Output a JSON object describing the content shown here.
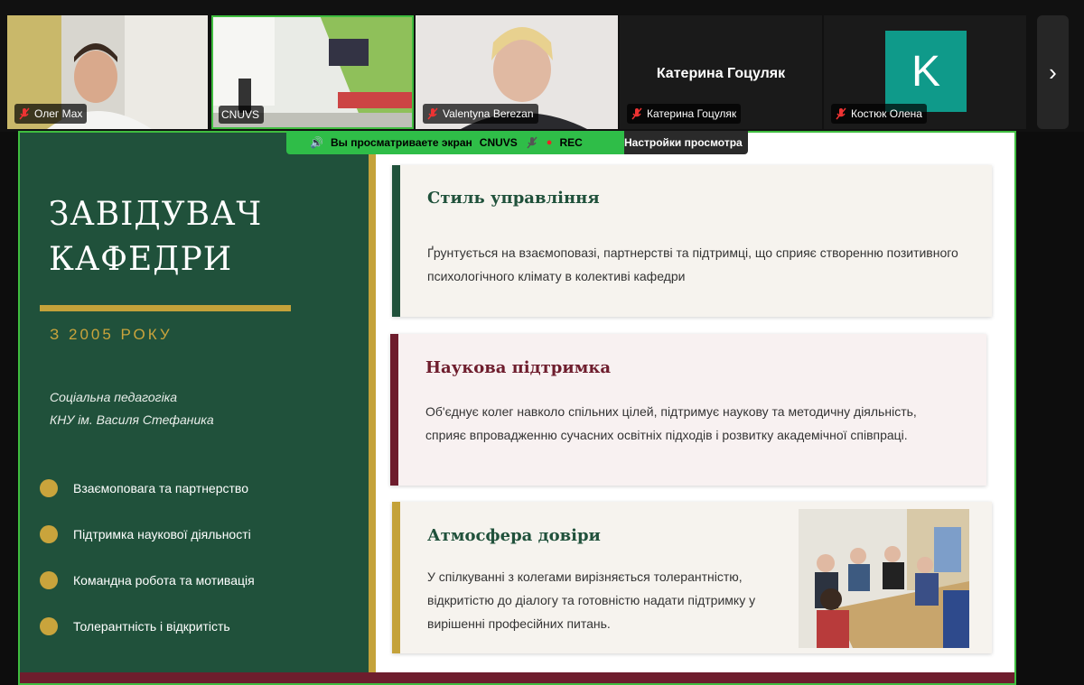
{
  "participants": [
    {
      "name": "Олег Мах"
    },
    {
      "name": "CNUVS"
    },
    {
      "name": "Valentyna Berezan"
    },
    {
      "name": "Катерина Гоцуляк",
      "display_name": "Катерина Гоцуляк"
    },
    {
      "name": "Костюк Олена",
      "avatar_letter": "K"
    }
  ],
  "share_banner": {
    "text": "Вы просматриваете экран",
    "presenter": "CNUVS",
    "rec": "REC",
    "view_settings": "Настройки просмотра"
  },
  "slide": {
    "title_line1": "ЗАВІДУВАЧ",
    "title_line2": "КАФЕДРИ",
    "since": "З 2005 РОКУ",
    "subtitle_line1": "Соціальна педагогіка",
    "subtitle_line2": "КНУ ім. Василя Стефаника",
    "bullets": [
      "Взаємоповага та партнерство",
      "Підтримка наукової діяльності",
      "Командна робота та мотивація",
      "Толерантність і відкритість"
    ],
    "cards": [
      {
        "heading": "Стиль управління",
        "body": "Ґрунтується на взаємоповазі, партнерстві та підтримці, що сприяє створенню позитивного психологічного клімату в колективі кафедри"
      },
      {
        "heading": "Наукова підтримка",
        "body": "Об'єднує колег навколо спільних цілей, підтримує наукову та методичну діяльність, сприяє впровадженню сучасних освітніх підходів і розвитку академічної співпраці."
      },
      {
        "heading": "Атмосфера довіри",
        "body": "У спілкуванні з колегами вирізняється толерантністю, відкритістю до діалогу та готовністю надати підтримку у вирішенні професійних питань."
      }
    ]
  },
  "colors": {
    "green": "#20513b",
    "gold": "#c4a23a",
    "burgundy": "#6e1d2d",
    "speaker_outline": "#3fbd3f"
  }
}
